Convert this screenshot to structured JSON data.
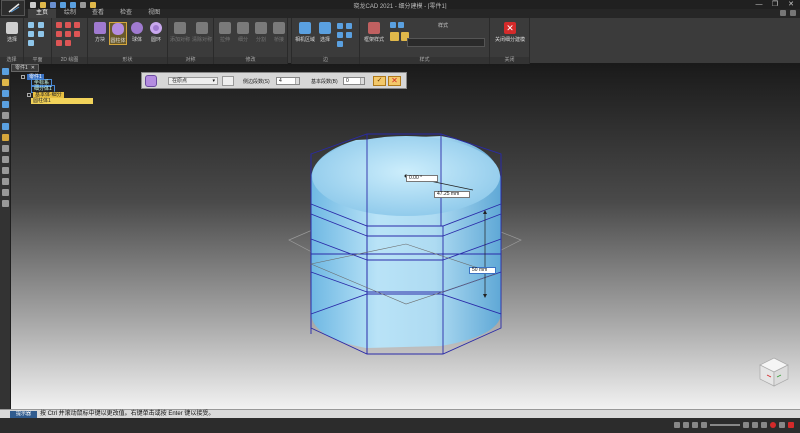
{
  "window": {
    "title": "晓龙CAD 2021 - 细分建模 - [零件1]",
    "controls": [
      "—",
      "❐",
      "✕"
    ]
  },
  "ribbon_tabs": [
    {
      "label": "主页",
      "active": true
    },
    {
      "label": "绘制",
      "active": false
    },
    {
      "label": "查看",
      "active": false
    },
    {
      "label": "检查",
      "active": false
    },
    {
      "label": "视图",
      "active": false
    }
  ],
  "ribbon_groups": {
    "select": {
      "label": "选择",
      "button": "选择"
    },
    "plane": {
      "label": "平面"
    },
    "sketch2d": {
      "label": "2D 绘图"
    },
    "shape": {
      "label": "形状",
      "buttons": [
        "方块",
        "圆柱体",
        "球体",
        "圆环"
      ]
    },
    "symmetry": {
      "label": "对称",
      "buttons": [
        "添加对称",
        "清除对称"
      ]
    },
    "modify": {
      "label": "修改",
      "buttons": [
        "拉伸",
        "细分",
        "分割",
        "桥接"
      ]
    },
    "edit": {
      "label": "局部"
    },
    "display": {
      "label": "边",
      "buttons": [
        "相机区域",
        "选择"
      ]
    },
    "style": {
      "label": "样式",
      "select_label": "样式",
      "button": "框架样式"
    },
    "close": {
      "label": "关闭",
      "button": "关闭细分建模"
    }
  },
  "doc_tab": {
    "label": "零件1",
    "close": "✕"
  },
  "tree": {
    "root": "零件1",
    "items": [
      "坐标系",
      "细分体1",
      "基本体·细分",
      "圆柱体1"
    ],
    "selected": "圆柱体1"
  },
  "op_toolbar": {
    "position_value": "在原点",
    "position_options": [
      "在原点"
    ],
    "circle_segments_label": "侧边段数(S)",
    "circle_segments_value": "4",
    "height_segments_label": "基本段数(B)",
    "height_segments_value": "0"
  },
  "dimensions": {
    "angle": "0.00 °",
    "radius": "47.25 mm",
    "height": "50 mm"
  },
  "status": {
    "tab": "提示器",
    "message": "按 Ctrl 并滚动鼠标中键以更改值。右键单击或按 Enter 键以接受。"
  },
  "colors": {
    "accent": "#d5a63c",
    "cylinder": "#9fd2ee",
    "cage": "#2a2aa8",
    "close_red": "#d42a2a"
  }
}
